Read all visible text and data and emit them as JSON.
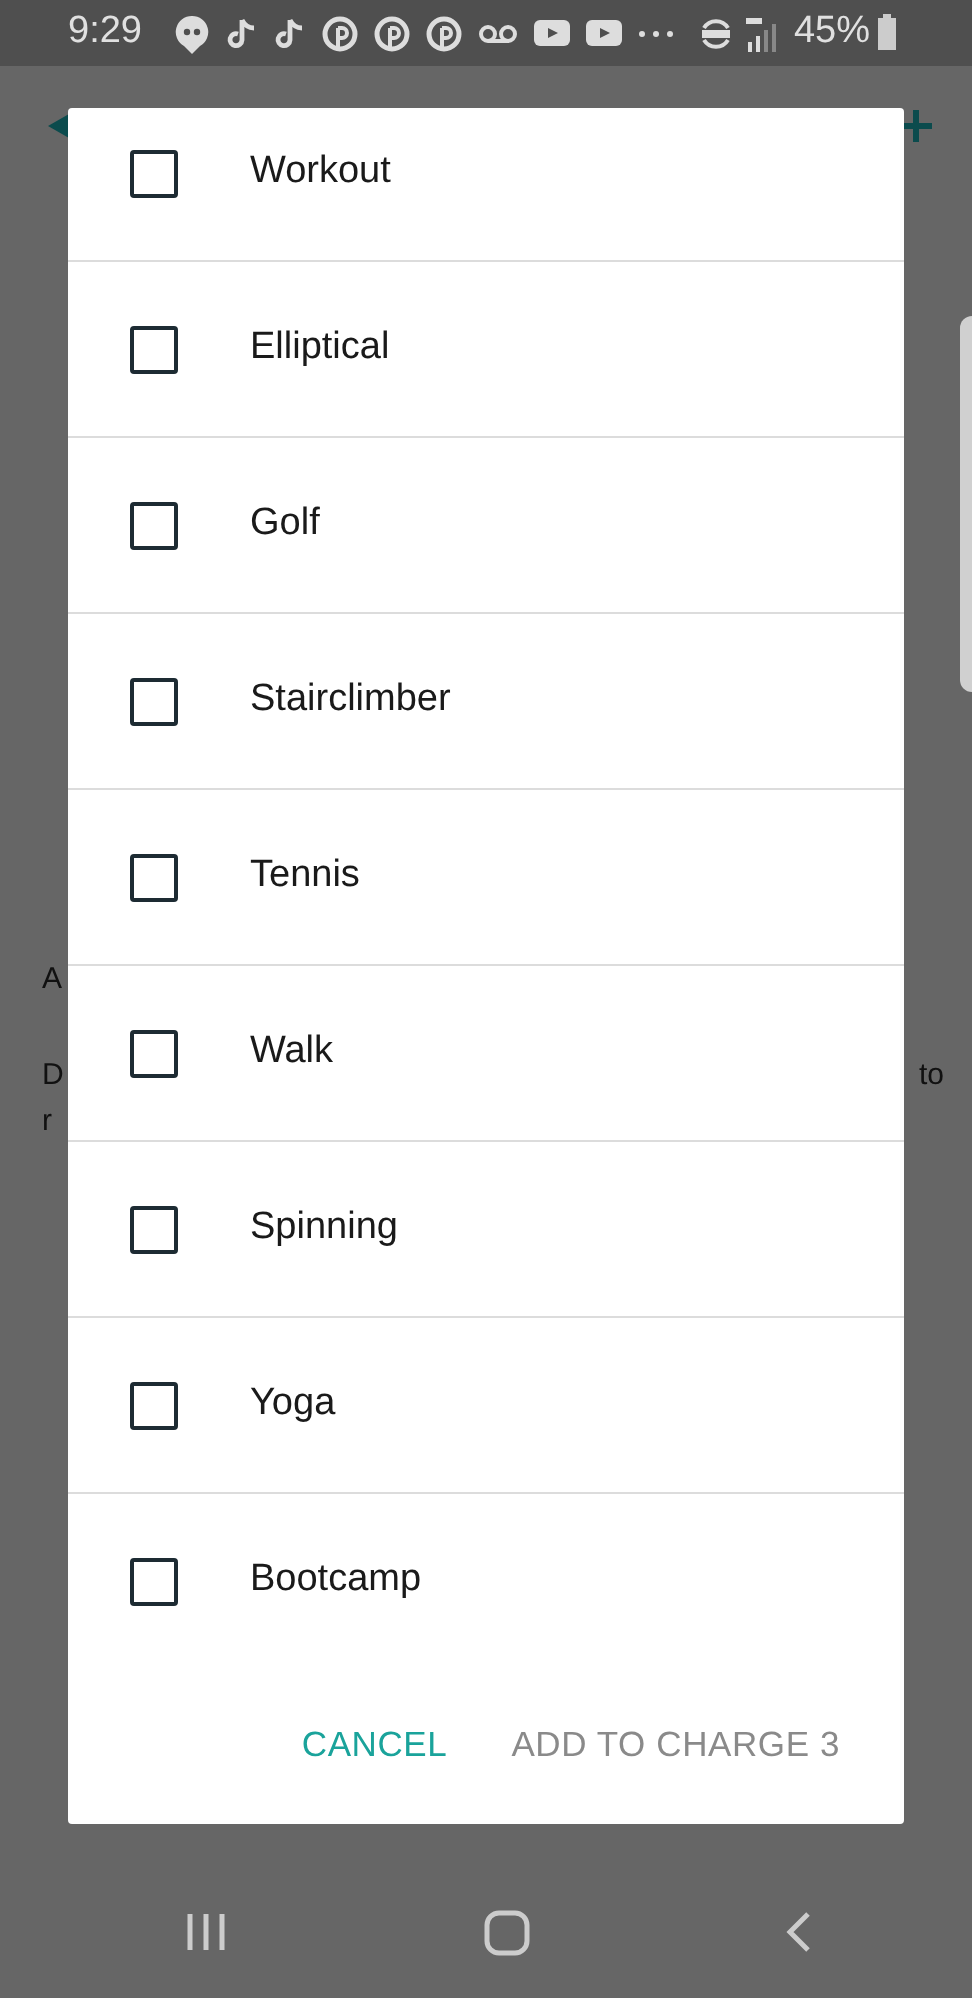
{
  "status_bar": {
    "time": "9:29",
    "battery": "45%"
  },
  "background": {
    "left_texts": [
      "A",
      "D",
      "r"
    ],
    "right_texts": [
      "to"
    ]
  },
  "dialog": {
    "items": [
      {
        "label": "Workout",
        "checked": false
      },
      {
        "label": "Elliptical",
        "checked": false
      },
      {
        "label": "Golf",
        "checked": false
      },
      {
        "label": "Stairclimber",
        "checked": false
      },
      {
        "label": "Tennis",
        "checked": false
      },
      {
        "label": "Walk",
        "checked": false
      },
      {
        "label": "Spinning",
        "checked": false
      },
      {
        "label": "Yoga",
        "checked": false
      },
      {
        "label": "Bootcamp",
        "checked": false
      }
    ],
    "buttons": [
      {
        "label": "CANCEL",
        "disabled": false
      },
      {
        "label": "ADD TO CHARGE 3",
        "disabled": true
      }
    ]
  }
}
